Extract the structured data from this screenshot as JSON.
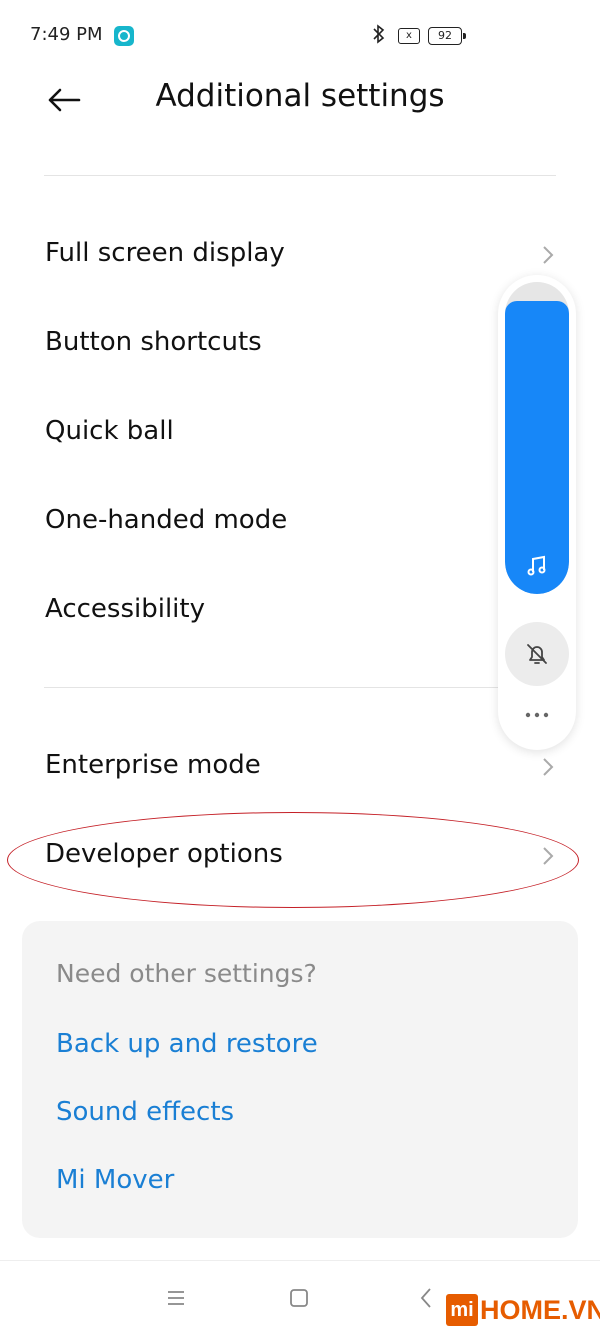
{
  "status_bar": {
    "time": "7:49 PM",
    "sim_icon": "x",
    "battery": "92"
  },
  "header": {
    "title": "Additional settings"
  },
  "menu_items": [
    {
      "label": "Full screen display"
    },
    {
      "label": "Button shortcuts"
    },
    {
      "label": "Quick ball"
    },
    {
      "label": "One-handed mode"
    },
    {
      "label": "Accessibility"
    },
    {
      "label": "Enterprise mode"
    },
    {
      "label": "Developer options"
    }
  ],
  "other_settings": {
    "title": "Need other settings?",
    "links": [
      {
        "label": "Back up and restore"
      },
      {
        "label": "Sound effects"
      },
      {
        "label": "Mi Mover"
      }
    ]
  },
  "volume_panel": {
    "level": 0.94,
    "fill_color": "#1787f8"
  },
  "watermark": {
    "logo_letters": "mi",
    "text": "HOME.VN",
    "color": "#e65c00"
  },
  "colors": {
    "link": "#1a7fd4",
    "highlight": "#c41f26"
  }
}
